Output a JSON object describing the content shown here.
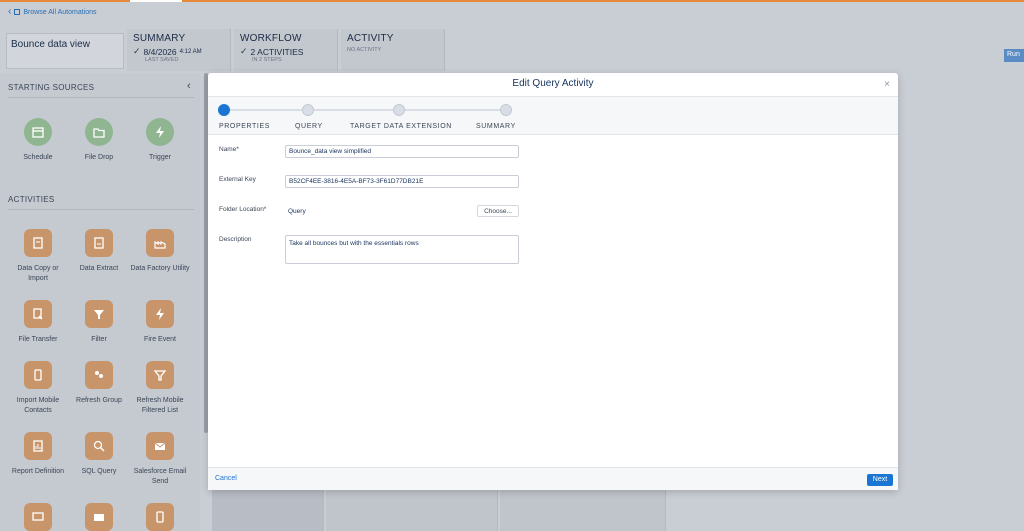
{
  "header": {
    "browse_link": "Browse All Automations",
    "automation_name": "Bounce data view",
    "tabs": [
      {
        "title": "SUMMARY",
        "value": "8/4/2026",
        "value_time": "4:12 AM",
        "sub": "LAST SAVED"
      },
      {
        "title": "WORKFLOW",
        "value": "2 ACTIVITIES",
        "sub": "IN 2 STEPS"
      },
      {
        "title": "ACTIVITY",
        "value": "",
        "sub": "NO ACTIVITY"
      }
    ],
    "run_label": "Run"
  },
  "sidebar": {
    "starting_sources_title": "STARTING SOURCES",
    "sources": [
      {
        "label": "Schedule",
        "icon": "calendar-icon"
      },
      {
        "label": "File Drop",
        "icon": "folder-drop-icon"
      },
      {
        "label": "Trigger",
        "icon": "lightning-icon"
      }
    ],
    "activities_title": "ACTIVITIES",
    "activities": [
      {
        "label": "Data Copy or Import",
        "icon": "data-import-icon"
      },
      {
        "label": "Data Extract",
        "icon": "data-extract-icon"
      },
      {
        "label": "Data Factory Utility",
        "icon": "data-factory-icon"
      },
      {
        "label": "File Transfer",
        "icon": "file-transfer-icon"
      },
      {
        "label": "Filter",
        "icon": "filter-icon"
      },
      {
        "label": "Fire Event",
        "icon": "fire-event-icon"
      },
      {
        "label": "Import Mobile Contacts",
        "icon": "import-mobile-icon"
      },
      {
        "label": "Refresh Group",
        "icon": "refresh-group-icon"
      },
      {
        "label": "Refresh Mobile Filtered List",
        "icon": "refresh-mobile-icon"
      },
      {
        "label": "Report Definition",
        "icon": "report-icon"
      },
      {
        "label": "SQL Query",
        "icon": "sql-query-icon"
      },
      {
        "label": "Salesforce Email Send",
        "icon": "email-send-icon"
      },
      {
        "label": "",
        "icon": "chat-icon"
      },
      {
        "label": "",
        "icon": "envelope-icon"
      },
      {
        "label": "",
        "icon": "mobile-icon"
      }
    ]
  },
  "modal": {
    "title": "Edit Query Activity",
    "close": "×",
    "steps": [
      "PROPERTIES",
      "QUERY",
      "TARGET DATA EXTENSION",
      "SUMMARY"
    ],
    "active_step": 0,
    "fields": {
      "name_label": "Name*",
      "name_value": "Bounce_data view simplified",
      "key_label": "External Key",
      "key_value": "B52CF4EE-3816-4E5A-BF73-3F61D77DB21E",
      "folder_label": "Folder Location*",
      "folder_value": "Query",
      "choose_label": "Choose...",
      "desc_label": "Description",
      "desc_value": "Take all bounces but with the essentials rows"
    },
    "cancel_label": "Cancel",
    "next_label": "Next"
  },
  "colors": {
    "accent_orange": "#e8883a",
    "primary_blue": "#1b76d3",
    "source_green": "#8fb690",
    "activity_tan": "#c8956a"
  }
}
